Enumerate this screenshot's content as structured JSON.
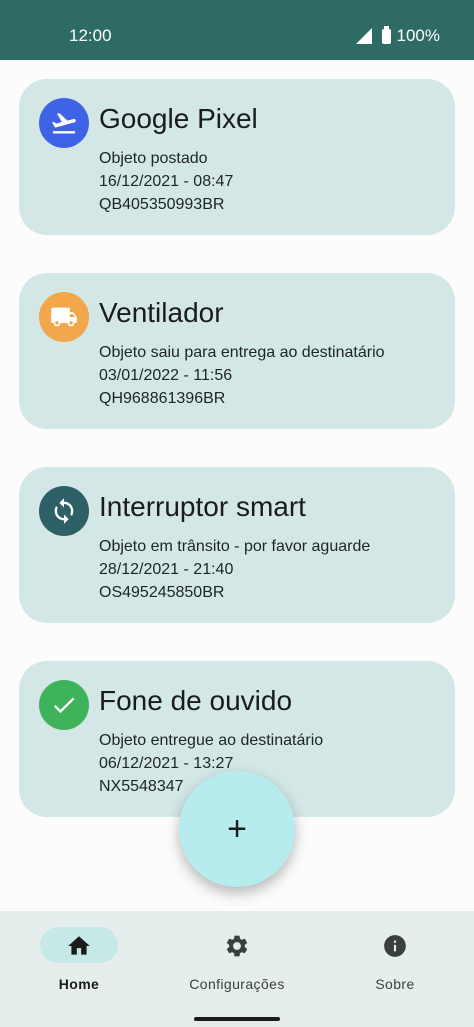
{
  "status": {
    "time": "12:00",
    "battery": "100%"
  },
  "cards": [
    {
      "title": "Google Pixel",
      "status": "Objeto postado",
      "datetime": "16/12/2021 - 08:47",
      "code": "QB405350993BR",
      "icon": "airplane-takeoff-icon",
      "color": "#3e63e6"
    },
    {
      "title": "Ventilador",
      "status": "Objeto saiu para entrega ao destinatário",
      "datetime": "03/01/2022 - 11:56",
      "code": "QH968861396BR",
      "icon": "truck-icon",
      "color": "#f2a84a"
    },
    {
      "title": "Interruptor smart",
      "status": "Objeto em trânsito - por favor aguarde",
      "datetime": "28/12/2021 - 21:40",
      "code": "OS495245850BR",
      "icon": "sync-icon",
      "color": "#2d5f66"
    },
    {
      "title": "Fone de ouvido",
      "status": "Objeto entregue ao destinatário",
      "datetime": "06/12/2021 - 13:27",
      "code": "NX5548347",
      "icon": "check-icon",
      "color": "#3eb35b"
    }
  ],
  "fab": {
    "symbol": "+"
  },
  "nav": [
    {
      "label": "Home",
      "icon": "home-icon",
      "active": true
    },
    {
      "label": "Configurações",
      "icon": "gear-icon",
      "active": false
    },
    {
      "label": "Sobre",
      "icon": "info-icon",
      "active": false
    }
  ]
}
